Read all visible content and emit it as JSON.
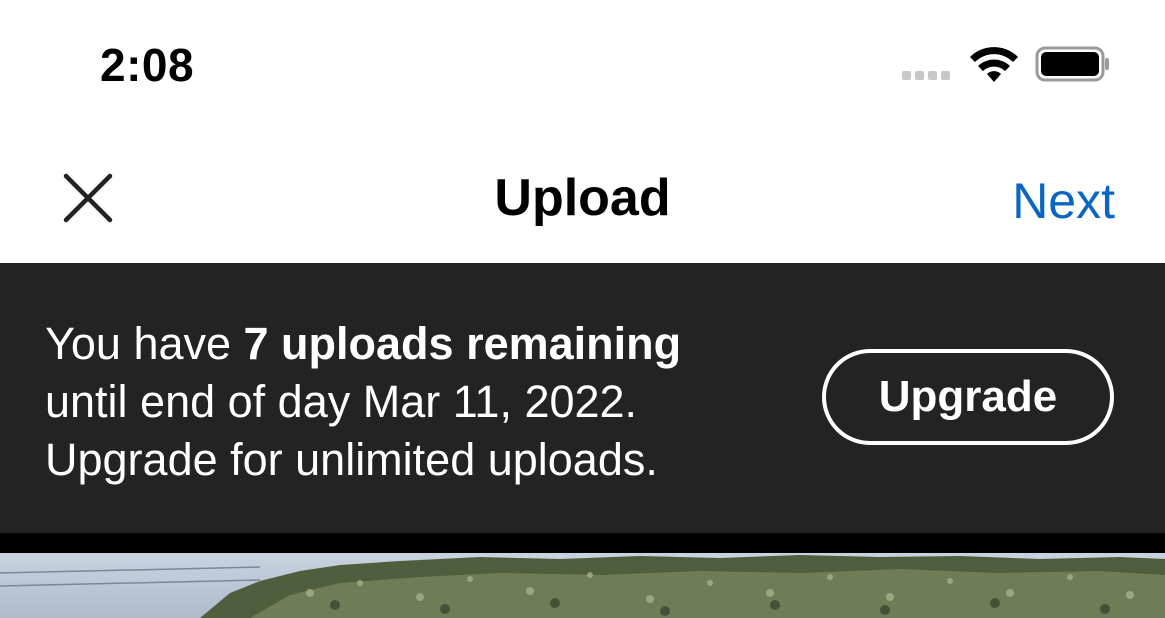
{
  "status_bar": {
    "time": "2:08",
    "icons": [
      "signal-icon",
      "wifi-icon",
      "battery-icon"
    ]
  },
  "nav": {
    "close_icon": "close-icon",
    "title": "Upload",
    "next_label": "Next"
  },
  "banner": {
    "line1_prefix": "You have ",
    "line1_bold": "7 uploads remaining",
    "line2": "until end of day Mar 11, 2022.",
    "line3": "Upgrade for unlimited uploads.",
    "button_label": "Upgrade"
  },
  "colors": {
    "accent": "#0a66c2",
    "banner_bg": "#232323",
    "text_primary": "#000000",
    "text_on_dark": "#ffffff"
  }
}
